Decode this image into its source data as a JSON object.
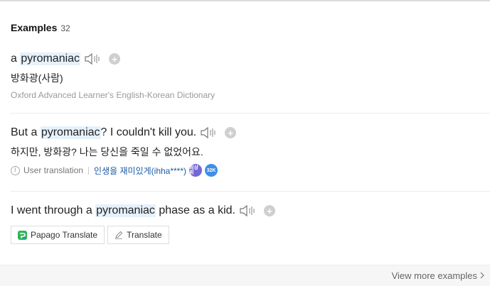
{
  "section": {
    "title": "Examples",
    "count": "32"
  },
  "examples": [
    {
      "before": "a ",
      "highlight": "pyromaniac",
      "after": "",
      "meaning": "방화광(사람)",
      "source": "Oxford Advanced Learner's English-Korean Dictionary"
    },
    {
      "before": "But a ",
      "highlight": "pyromaniac",
      "after": "? I couldn't kill you.",
      "meaning": "하지만, 방화광? 나는 당신을 죽일 수 없었어요.",
      "user_translation_label": "User translation",
      "contributor": "인생을 재미있게(ihha****)",
      "badges": [
        "최상위",
        "32K"
      ]
    },
    {
      "before": "I went through a ",
      "highlight": "pyromaniac",
      "after": " phase as a kid.",
      "buttons": {
        "papago": "Papago Translate",
        "translate": "Translate"
      }
    }
  ],
  "footer": {
    "view_more": "View more examples"
  },
  "icons": {
    "speaker": "speaker-icon",
    "add": "plus-icon",
    "info": "info-icon",
    "papago": "papago-logo-icon",
    "pencil": "pencil-icon",
    "chevron": "chevron-right-icon"
  },
  "colors": {
    "highlight": "#e6f1fb",
    "link": "#1b5aa6",
    "badge_purple": "#7567d6",
    "badge_blue": "#3f8ee8"
  }
}
